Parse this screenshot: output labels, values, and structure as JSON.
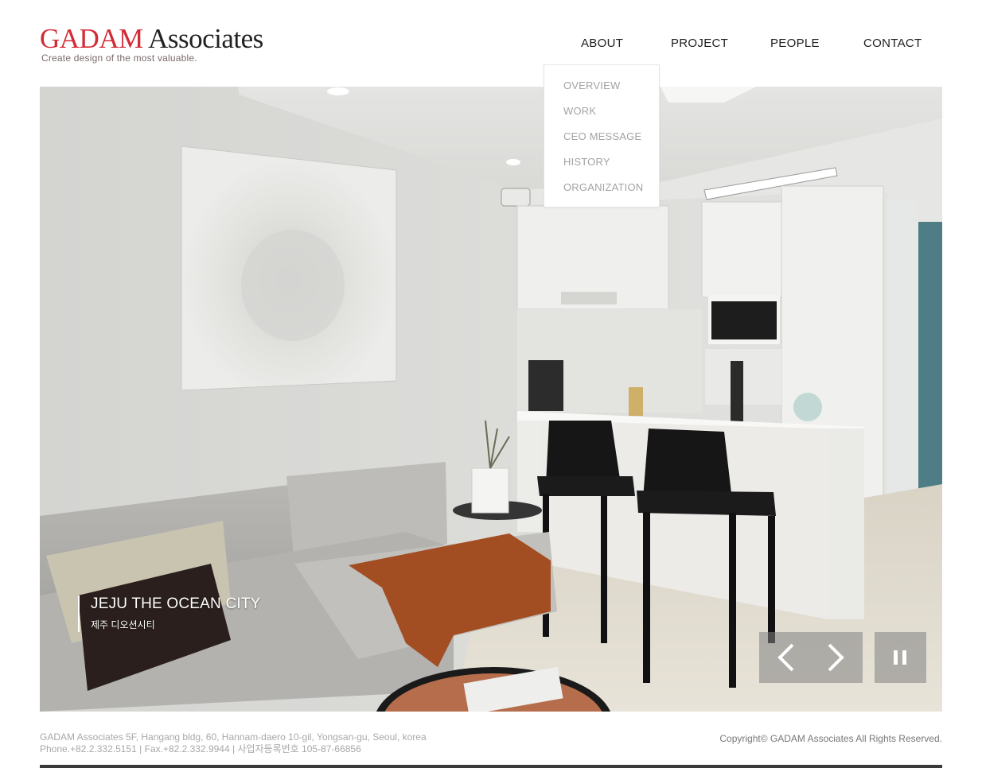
{
  "logo": {
    "brand": "GADAM",
    "name": "Associates",
    "tagline": "Create design of the most valuable."
  },
  "nav": {
    "items": [
      {
        "label": "ABOUT"
      },
      {
        "label": "PROJECT"
      },
      {
        "label": "PEOPLE"
      },
      {
        "label": "CONTACT"
      }
    ]
  },
  "dropdown": {
    "items": [
      {
        "label": "OVERVIEW"
      },
      {
        "label": "WORK"
      },
      {
        "label": "CEO MESSAGE"
      },
      {
        "label": "HISTORY"
      },
      {
        "label": "ORGANIZATION"
      }
    ]
  },
  "slide": {
    "title": "JEJU THE OCEAN CITY",
    "subtitle": "제주 디오션시티"
  },
  "controls": {
    "prev_icon": "chevron-left-icon",
    "next_icon": "chevron-right-icon",
    "pause_icon": "pause-icon"
  },
  "footer": {
    "address": "GADAM Associates 5F, Hangang bldg, 60, Hannam-daero 10-gil, Yongsan-gu, Seoul, korea",
    "contact": "Phone.+82.2.332.5151 | Fax.+82.2.332.9944 | 사업자등록번호 105-87-66856",
    "copyright": "Copyright© GADAM Associates All Rights Reserved."
  },
  "colors": {
    "brand_red": "#d32a36",
    "text_dark": "#222222",
    "dropdown_text": "#a3a3a3",
    "footer_text": "#a8a8a8"
  }
}
